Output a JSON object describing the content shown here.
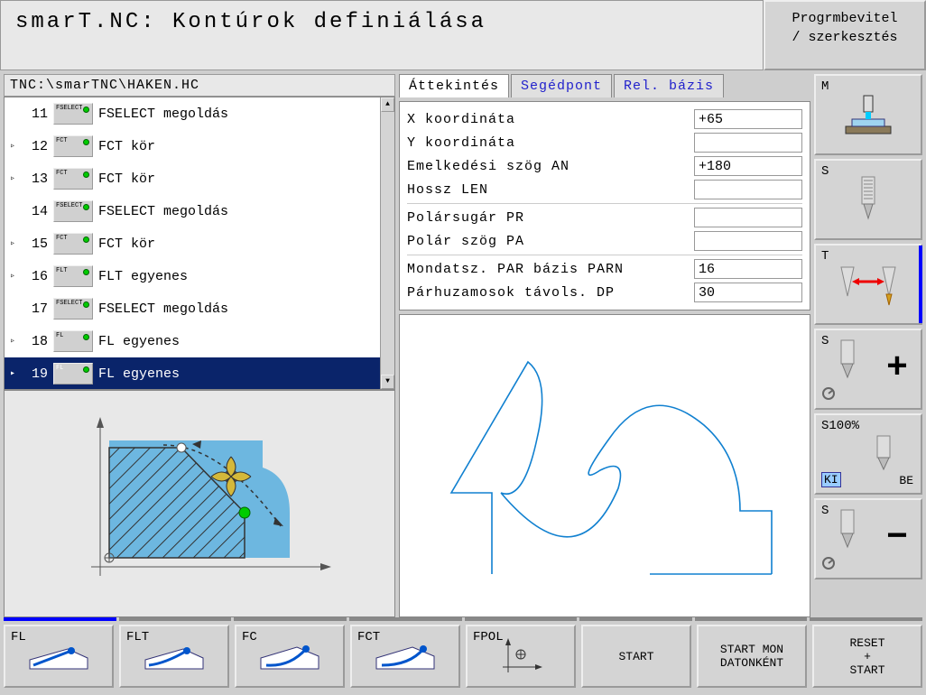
{
  "header": {
    "title": "smarT.NC: Kontúrok definiálása",
    "mode_line1": "Progrmbevitel",
    "mode_line2": "/ szerkesztés"
  },
  "path": "TNC:\\smarTNC\\HAKEN.HC",
  "tree": [
    {
      "num": "11",
      "exp": "",
      "icon": "FSELECT",
      "label": "FSELECT megoldás",
      "sel": false
    },
    {
      "num": "12",
      "exp": "▹",
      "icon": "FCT",
      "label": "FCT kör",
      "sel": false
    },
    {
      "num": "13",
      "exp": "▹",
      "icon": "FCT",
      "label": "FCT kör",
      "sel": false
    },
    {
      "num": "14",
      "exp": "",
      "icon": "FSELECT",
      "label": "FSELECT megoldás",
      "sel": false
    },
    {
      "num": "15",
      "exp": "▹",
      "icon": "FCT",
      "label": "FCT kör",
      "sel": false
    },
    {
      "num": "16",
      "exp": "▹",
      "icon": "FLT",
      "label": "FLT egyenes",
      "sel": false
    },
    {
      "num": "17",
      "exp": "",
      "icon": "FSELECT",
      "label": "FSELECT megoldás",
      "sel": false
    },
    {
      "num": "18",
      "exp": "▹",
      "icon": "FL",
      "label": "FL egyenes",
      "sel": false
    },
    {
      "num": "19",
      "exp": "▸",
      "icon": "FL",
      "label": "FL egyenes",
      "sel": true
    }
  ],
  "tabs": {
    "overview": "Áttekintés",
    "aux": "Segédpont",
    "relbase": "Rel. bázis"
  },
  "form": {
    "group1": [
      {
        "label": "X koordináta",
        "value": "+65"
      },
      {
        "label": "Y koordináta",
        "value": ""
      },
      {
        "label": "Emelkedési szög AN",
        "value": "+180"
      },
      {
        "label": "Hossz LEN",
        "value": ""
      }
    ],
    "group2": [
      {
        "label": "Polársugár PR",
        "value": ""
      },
      {
        "label": "Polár szög PA",
        "value": ""
      }
    ],
    "group3": [
      {
        "label": "Mondatsz. PAR bázis PARN",
        "value": "16"
      },
      {
        "label": "Párhuzamosok távols. DP",
        "value": "30"
      }
    ]
  },
  "side": {
    "m": "M",
    "s": "S",
    "t": "T",
    "splus": "S",
    "s100": "S100%",
    "ki": "KI",
    "be": "BE",
    "sminus": "S"
  },
  "softkeys": {
    "fl": "FL",
    "flt": "FLT",
    "fc": "FC",
    "fct": "FCT",
    "fpol": "FPOL",
    "start": "START",
    "startmon1": "START MON",
    "startmon2": "DATONKÉNT",
    "reset1": "RESET",
    "reset2": "+",
    "reset3": "START"
  }
}
